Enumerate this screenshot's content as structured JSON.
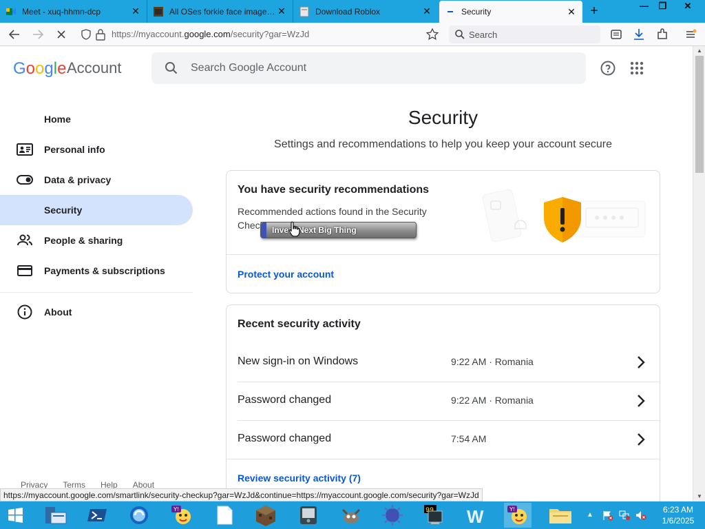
{
  "browser": {
    "tabs": [
      {
        "label": "Meet - xuq-hhmn-dcp",
        "active": false
      },
      {
        "label": "All OSes forkie face image.jpg",
        "active": false
      },
      {
        "label": "Download Roblox",
        "active": false
      },
      {
        "label": "Security",
        "active": true
      }
    ],
    "tab_close": "✕",
    "new_tab": "+",
    "window_buttons": {
      "minimize": "—",
      "restore": "❐",
      "close": "✕"
    },
    "url_prefix": "https://myaccount.",
    "url_domain": "google.com",
    "url_suffix": "/security?gar=WzJd",
    "search_placeholder": "Search",
    "hover_url": "https://myaccount.google.com/smartlink/security-checkup?gar=WzJd&continue=https://myaccount.google.com/security?gar=WzJd"
  },
  "header": {
    "logo_text": "Google",
    "logo_suffix": "Account",
    "search_placeholder": "Search Google Account"
  },
  "sidebar": {
    "items": [
      {
        "label": "Home",
        "icon": "home-icon"
      },
      {
        "label": "Personal info",
        "icon": "id-card-icon"
      },
      {
        "label": "Data & privacy",
        "icon": "toggle-icon"
      },
      {
        "label": "Security",
        "icon": "lock-icon",
        "active": true
      },
      {
        "label": "People & sharing",
        "icon": "people-icon"
      },
      {
        "label": "Payments & subscriptions",
        "icon": "credit-card-icon"
      },
      {
        "label": "About",
        "icon": "info-icon"
      }
    ],
    "footer_links": [
      "Privacy",
      "Terms",
      "Help",
      "About"
    ]
  },
  "main": {
    "title": "Security",
    "subtitle": "Settings and recommendations to help you keep your account secure",
    "recommendations": {
      "title": "You have security recommendations",
      "text": "Recommended actions found in the Security Checkup",
      "link": "Protect your account"
    },
    "activity": {
      "title": "Recent security activity",
      "rows": [
        {
          "event": "New sign-in on Windows",
          "meta": "9:22 AM · Romania"
        },
        {
          "event": "Password changed",
          "meta": "9:22 AM · Romania"
        },
        {
          "event": "Password changed",
          "meta": "7:54 AM"
        }
      ],
      "link": "Review security activity (7)"
    }
  },
  "popup": {
    "text": "Invest Next Big Thing"
  },
  "taskbar": {
    "apps": [
      "start-button",
      "file-explorer",
      "powershell",
      "browser-app",
      "yahoo-messenger",
      "notepad",
      "minecraft",
      "media-player",
      "gimp",
      "spiky-app",
      "terminal",
      "word-app",
      "yahoo-messenger-2",
      "folder"
    ],
    "time": "6:23 AM",
    "date": "1/6/2025"
  },
  "colors": {
    "accent": "#0b57d0",
    "sidebar_active": "#d3e3fd",
    "taskbar": "#1e9fdb",
    "tabstrip": "#1ea5e0"
  }
}
